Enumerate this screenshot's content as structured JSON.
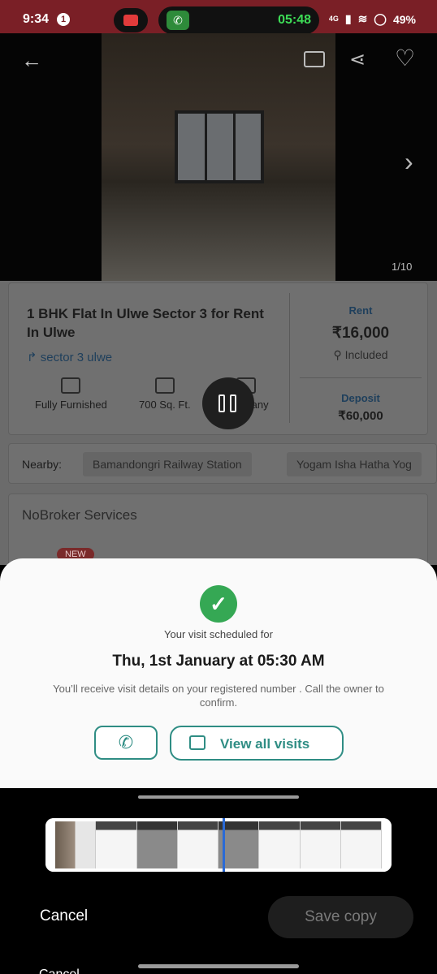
{
  "status_bar": {
    "time": "9:34",
    "notification_count": "1",
    "call_timer": "05:48",
    "network": "4G",
    "battery": "49%"
  },
  "photo": {
    "counter": "1/10"
  },
  "listing": {
    "title": "1 BHK Flat In Ulwe Sector 3 for Rent In Ulwe",
    "location": "sector 3 ulwe",
    "features": [
      {
        "label": "Fully Furnished",
        "icon": "sofa-icon"
      },
      {
        "label": "700 Sq. Ft.",
        "icon": "area-icon"
      },
      {
        "label": "Company",
        "icon": "people-icon"
      }
    ],
    "rent_label": "Rent",
    "rent_value": "₹16,000",
    "maintenance": "Included",
    "deposit_label": "Deposit",
    "deposit_value": "₹60,000"
  },
  "nearby": {
    "label": "Nearby:",
    "places": [
      "Bamandongri Railway Station",
      "Yogam Isha Hatha Yog"
    ]
  },
  "services": {
    "title": "NoBroker Services",
    "badge": "NEW"
  },
  "visit_sheet": {
    "subtitle": "Your visit scheduled for",
    "date_time": "Thu, 1st January at 05:30 AM",
    "note": "You’ll receive visit details on your registered number . Call the owner to confirm.",
    "view_visits_label": "View all visits"
  },
  "editor": {
    "cancel_label": "Cancel",
    "save_label": "Save copy",
    "peek_text": "Cancel"
  },
  "colors": {
    "status_bar": "#7a1f26",
    "accent": "#2f8d84",
    "success": "#35a854",
    "playhead": "#2a6ad6"
  }
}
